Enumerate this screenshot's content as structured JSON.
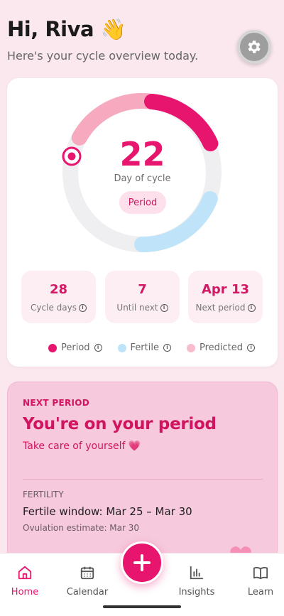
{
  "header": {
    "greeting": "Hi, Riva 👋",
    "subtitle": "Here's your cycle overview today."
  },
  "settings": {
    "icon": "gear-icon"
  },
  "cycle": {
    "day": "22",
    "day_label": "Day of cycle",
    "phase": "Period",
    "colors": {
      "period": "#e8156f",
      "fertile": "#bfe3f8",
      "predicted": "#f6a9bf",
      "track": "#efeff1"
    }
  },
  "stats": [
    {
      "value": "28",
      "label": "Cycle days"
    },
    {
      "value": "7",
      "label": "Until next"
    },
    {
      "value": "Apr 13",
      "label": "Next period"
    }
  ],
  "legend": [
    {
      "label": "Period",
      "color": "#e8156f"
    },
    {
      "label": "Fertile",
      "color": "#bfe3f8"
    },
    {
      "label": "Predicted",
      "color": "#f9bccd"
    }
  ],
  "next_period": {
    "kicker": "NEXT PERIOD",
    "title": "You're on your period",
    "subtitle": "Take care of yourself 💗",
    "fertility_kicker": "FERTILITY",
    "fertile_window": "Fertile window: Mar 25 – Mar 30",
    "ovulation": "Ovulation estimate: Mar 30"
  },
  "nav": [
    {
      "label": "Home",
      "icon": "home-icon",
      "active": true
    },
    {
      "label": "Calendar",
      "icon": "calendar-icon",
      "active": false
    },
    {
      "label": "Insights",
      "icon": "insights-icon",
      "active": false
    },
    {
      "label": "Learn",
      "icon": "book-icon",
      "active": false
    }
  ],
  "fab": {
    "icon": "plus-icon"
  }
}
